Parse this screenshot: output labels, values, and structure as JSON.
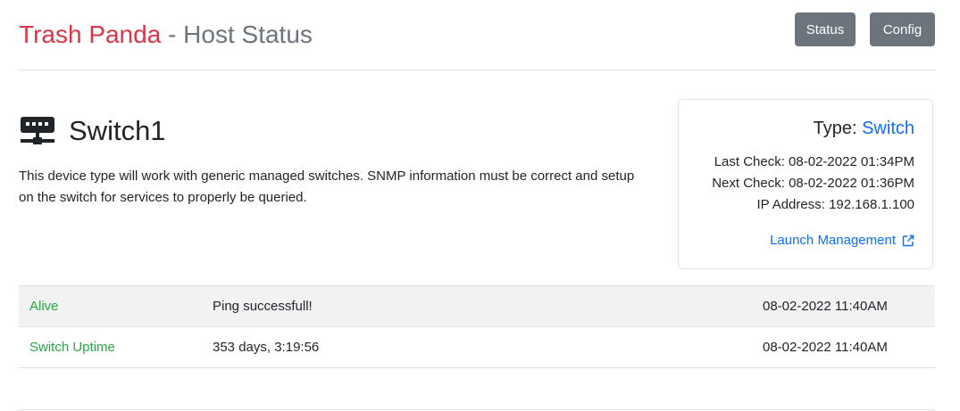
{
  "header": {
    "brand": "Trash Panda",
    "separator": "-",
    "page_title": "Host Status",
    "nav": {
      "status_label": "Status",
      "config_label": "Config"
    }
  },
  "device": {
    "icon": "network-switch-icon",
    "name": "Switch1",
    "description": "This device type will work with generic managed switches. SNMP information must be correct and setup on the switch for services to properly be queried."
  },
  "info_card": {
    "type_label": "Type:",
    "type_value": "Switch",
    "last_check": "Last Check: 08-02-2022 01:34PM",
    "next_check": "Next Check: 08-02-2022 01:36PM",
    "ip_address": "IP Address: 192.168.1.100",
    "launch_label": "Launch Management",
    "launch_icon": "external-link-icon"
  },
  "services": [
    {
      "name": "Alive",
      "message": "Ping successfull!",
      "timestamp": "08-02-2022 11:40AM"
    },
    {
      "name": "Switch Uptime",
      "message": "353 days, 3:19:56",
      "timestamp": "08-02-2022 11:40AM"
    }
  ],
  "colors": {
    "brand": "#dc3545",
    "muted": "#6c757d",
    "link": "#0d6efd",
    "service_ok": "#28a745"
  }
}
